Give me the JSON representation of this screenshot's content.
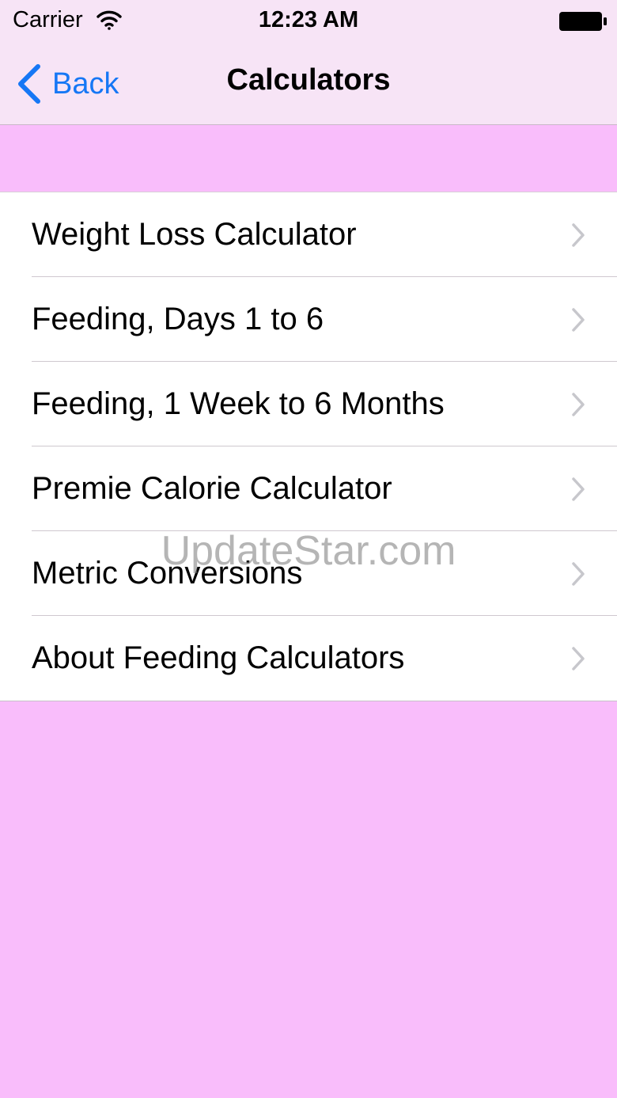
{
  "status_bar": {
    "carrier": "Carrier",
    "time": "12:23 AM"
  },
  "nav": {
    "back_label": "Back",
    "title": "Calculators"
  },
  "menu": {
    "items": [
      {
        "label": "Weight Loss Calculator"
      },
      {
        "label": "Feeding, Days 1 to 6"
      },
      {
        "label": "Feeding, 1 Week to 6 Months"
      },
      {
        "label": "Premie Calorie Calculator"
      },
      {
        "label": "Metric Conversions"
      },
      {
        "label": "About Feeding Calculators"
      }
    ]
  },
  "watermark": "UpdateStar.com",
  "colors": {
    "background": "#f9bdfb",
    "nav_background": "#f7e4f6",
    "accent": "#1677f5",
    "chevron": "#c7c7cc"
  },
  "icons": {
    "wifi": "wifi-icon",
    "battery": "battery-icon",
    "back": "chevron-left-icon",
    "row_disclosure": "chevron-right-icon"
  }
}
